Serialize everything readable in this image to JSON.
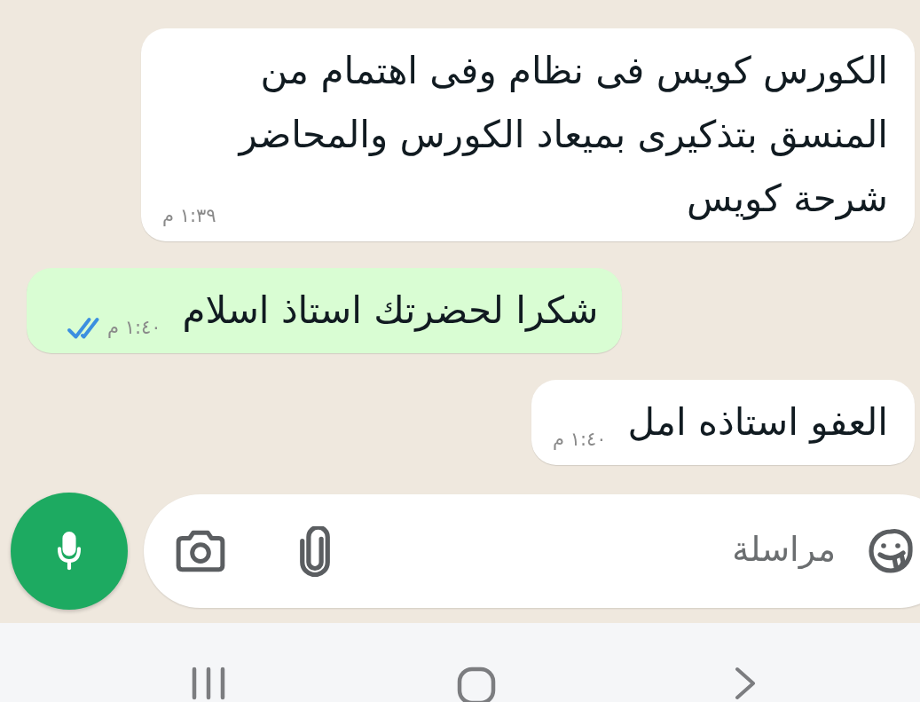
{
  "messages": [
    {
      "kind": "incoming",
      "text": "الكورس كويس فى نظام وفى اهتمام من المنسق بتذكيرى بميعاد الكورس والمحاضر شرحة كويس",
      "time": "١:٣٩ م"
    },
    {
      "kind": "outgoing",
      "text": "شكرا لحضرتك استاذ اسلام",
      "time": "١:٤٠ م",
      "read": true
    },
    {
      "kind": "incoming",
      "text": "العفو استاذه امل",
      "time": "١:٤٠ م"
    }
  ],
  "composer": {
    "placeholder": "مراسلة"
  }
}
